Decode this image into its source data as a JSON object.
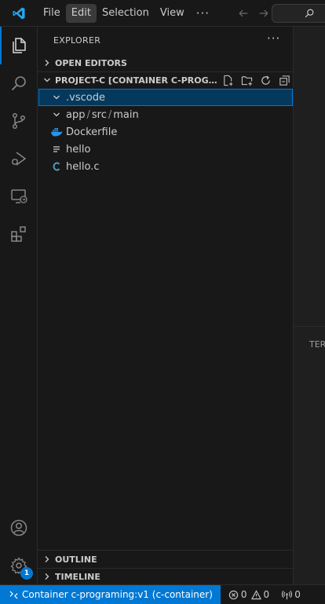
{
  "menu": {
    "items": [
      "File",
      "Edit",
      "Selection",
      "View"
    ],
    "active": "Edit",
    "more": "···"
  },
  "sidebar": {
    "title": "EXPLORER",
    "more": "···",
    "open_editors": "OPEN EDITORS",
    "project": "PROJECT-C [CONTAINER C-PROGRAM...",
    "outline": "OUTLINE",
    "timeline": "TIMELINE"
  },
  "tree": [
    {
      "label": ".vscode",
      "kind": "folder",
      "expanded": true,
      "selected": true
    },
    {
      "label_parts": [
        "app",
        "src",
        "main"
      ],
      "kind": "folder",
      "expanded": true,
      "selected": false
    },
    {
      "label": "Dockerfile",
      "kind": "docker",
      "selected": false
    },
    {
      "label": "hello",
      "kind": "text",
      "selected": false
    },
    {
      "label": "hello.c",
      "kind": "c",
      "selected": false
    }
  ],
  "activity": {
    "accounts_badge": "1"
  },
  "panel": {
    "title": "TERI"
  },
  "status": {
    "remote": "Container c-programing:v1 (c-container)",
    "errors": "0",
    "warnings": "0",
    "ports": "0"
  },
  "colors": {
    "accent": "#0078d4",
    "c_icon": "#519aba",
    "docker_icon": "#2496ed"
  }
}
